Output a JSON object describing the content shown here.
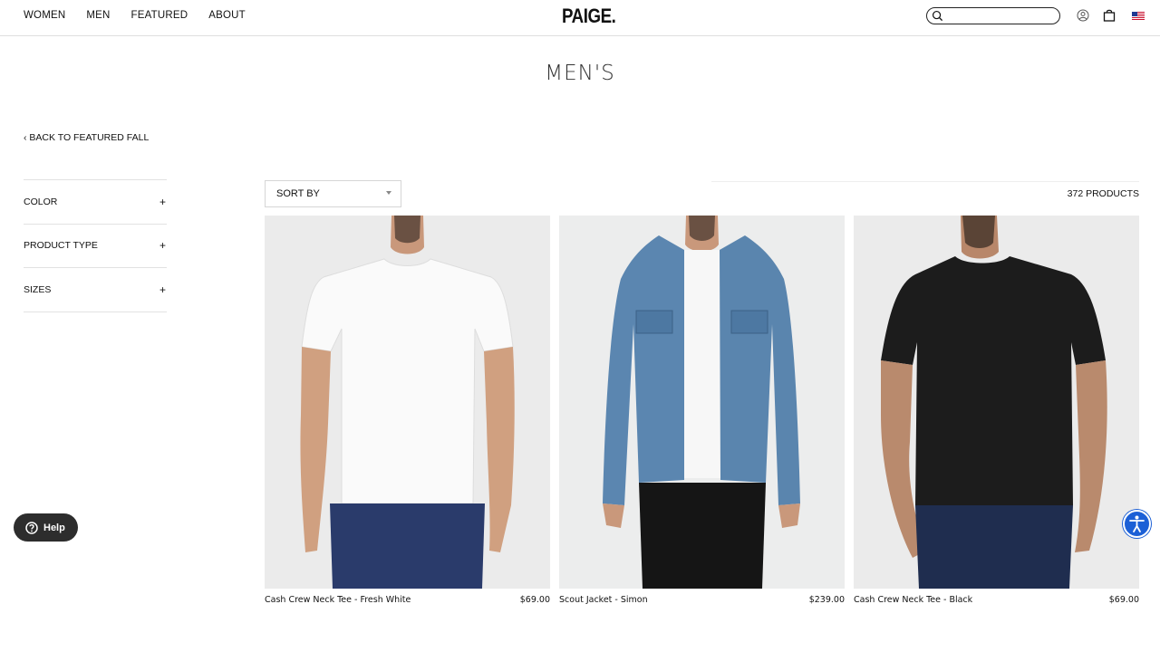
{
  "nav": [
    "WOMEN",
    "MEN",
    "FEATURED",
    "ABOUT"
  ],
  "logo": "PAIGE.",
  "search": {
    "placeholder": ""
  },
  "header_icons": [
    "search-icon",
    "account-icon",
    "cart-icon",
    "us-flag-icon"
  ],
  "page_title": "MEN'S",
  "back_link": "‹ BACK TO FEATURED FALL",
  "filters": [
    {
      "label": "COLOR",
      "icon": "+"
    },
    {
      "label": "PRODUCT TYPE",
      "icon": "+"
    },
    {
      "label": "SIZES",
      "icon": "+"
    }
  ],
  "sort_label": "SORT BY",
  "product_count": "372 PRODUCTS",
  "products": [
    {
      "name": "Cash Crew Neck Tee - Fresh White",
      "price": "$69.00"
    },
    {
      "name": "Scout Jacket - Simon",
      "price": "$239.00"
    },
    {
      "name": "Cash Crew Neck Tee - Black",
      "price": "$69.00"
    }
  ],
  "help_label": "Help",
  "colors": {
    "accessibility": "#1c60d6",
    "help_bg": "#2d2d2d",
    "image_bg": "#ebebeb"
  }
}
